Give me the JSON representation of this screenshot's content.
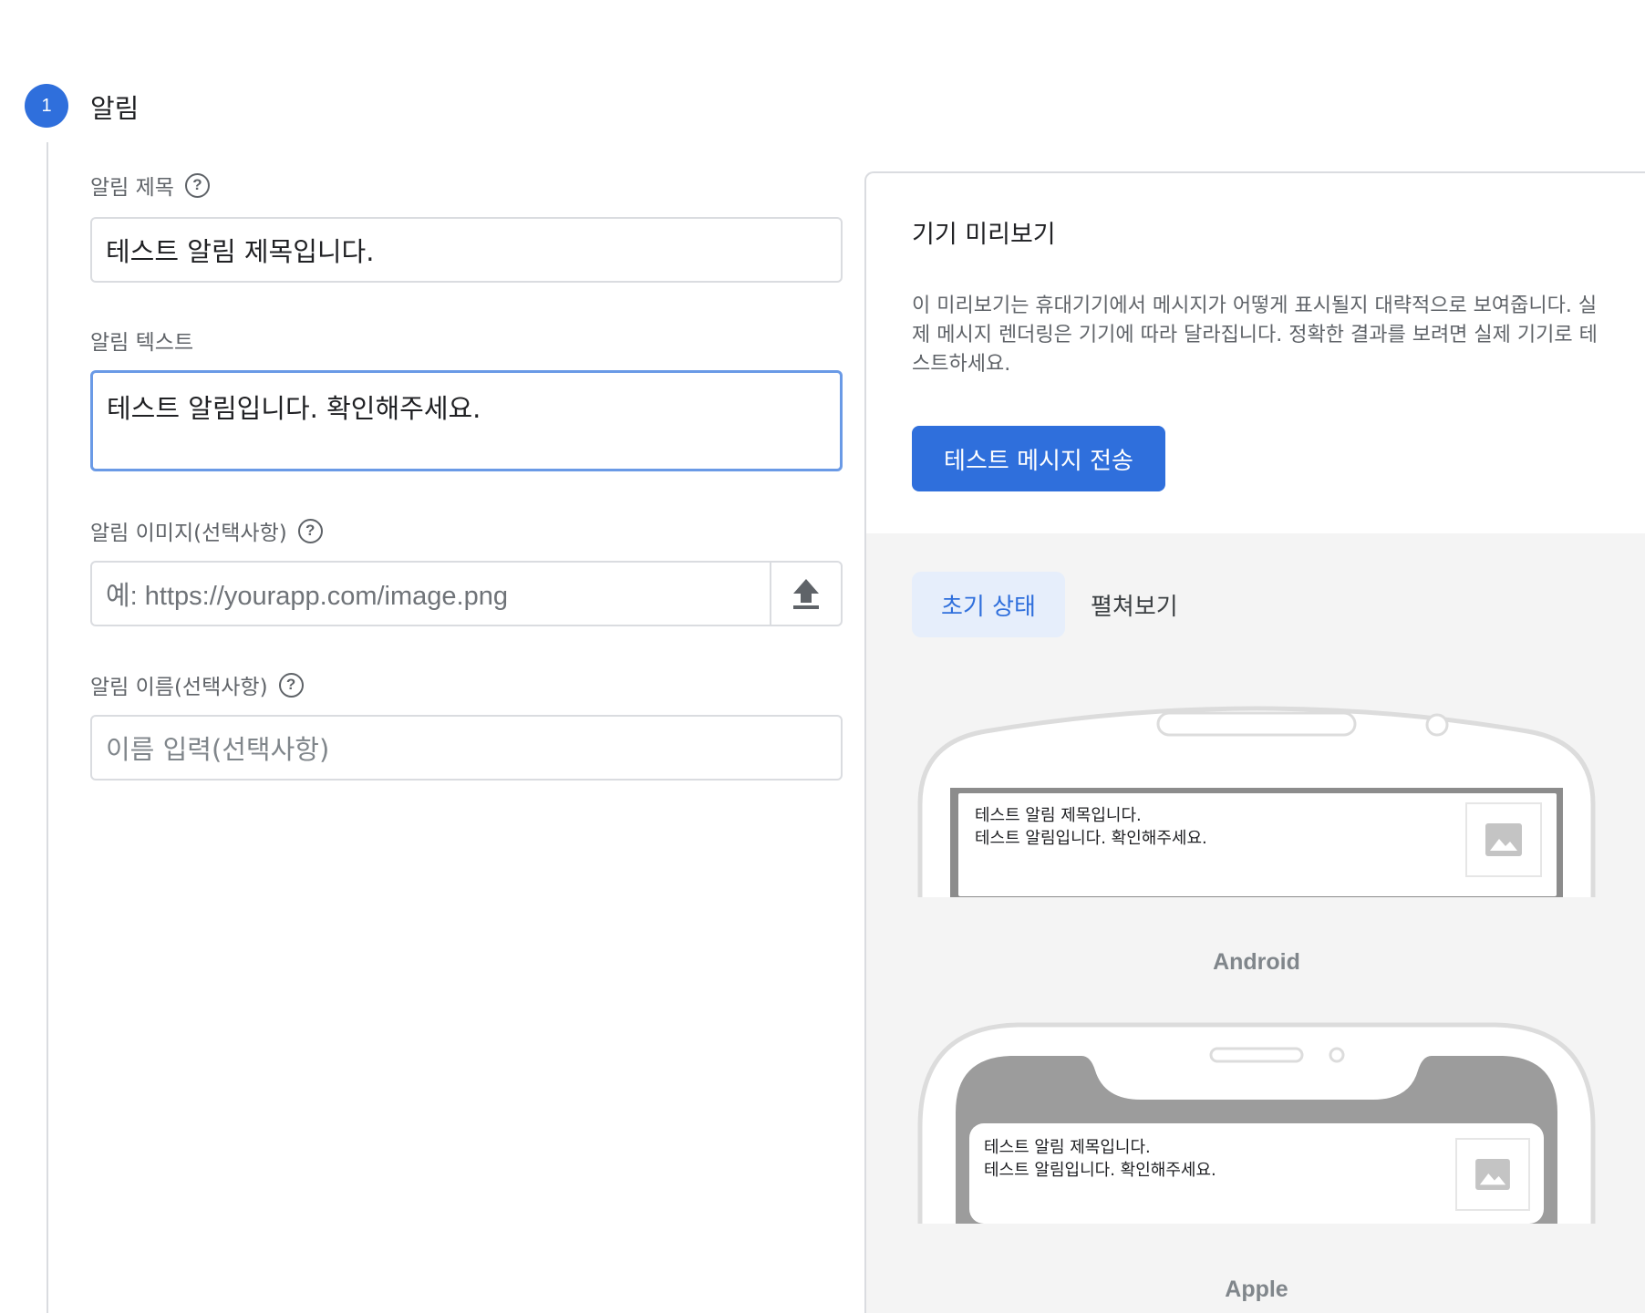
{
  "step": {
    "number": "1",
    "title": "알림"
  },
  "form": {
    "title_field": {
      "label": "알림 제목",
      "value": "테스트 알림 제목입니다."
    },
    "text_field": {
      "label": "알림 텍스트",
      "value": "테스트 알림입니다. 확인해주세요."
    },
    "image_field": {
      "label": "알림 이미지(선택사항)",
      "placeholder": "예: https://yourapp.com/image.png"
    },
    "name_field": {
      "label": "알림 이름(선택사항)",
      "placeholder": "이름 입력(선택사항)"
    },
    "help_glyph": "?"
  },
  "preview": {
    "title": "기기 미리보기",
    "description": "이 미리보기는 휴대기기에서 메시지가 어떻게 표시될지 대략적으로 보여줍니다. 실제 메시지 렌더링은 기기에 따라 달라집니다. 정확한 결과를 보려면 실제 기기로 테스트하세요.",
    "test_button": "테스트 메시지 전송",
    "tabs": [
      {
        "label": "초기 상태",
        "active": true
      },
      {
        "label": "펼쳐보기",
        "active": false
      }
    ],
    "android": {
      "label": "Android",
      "notif_title": "테스트 알림 제목입니다.",
      "notif_body": "테스트 알림입니다. 확인해주세요."
    },
    "apple": {
      "label": "Apple",
      "notif_title": "테스트 알림 제목입니다.",
      "notif_body": "테스트 알림입니다. 확인해주세요."
    }
  },
  "colors": {
    "accent": "#2f6fdc",
    "focus_border": "#6a9ae6",
    "panel_gray": "#f4f4f4"
  }
}
